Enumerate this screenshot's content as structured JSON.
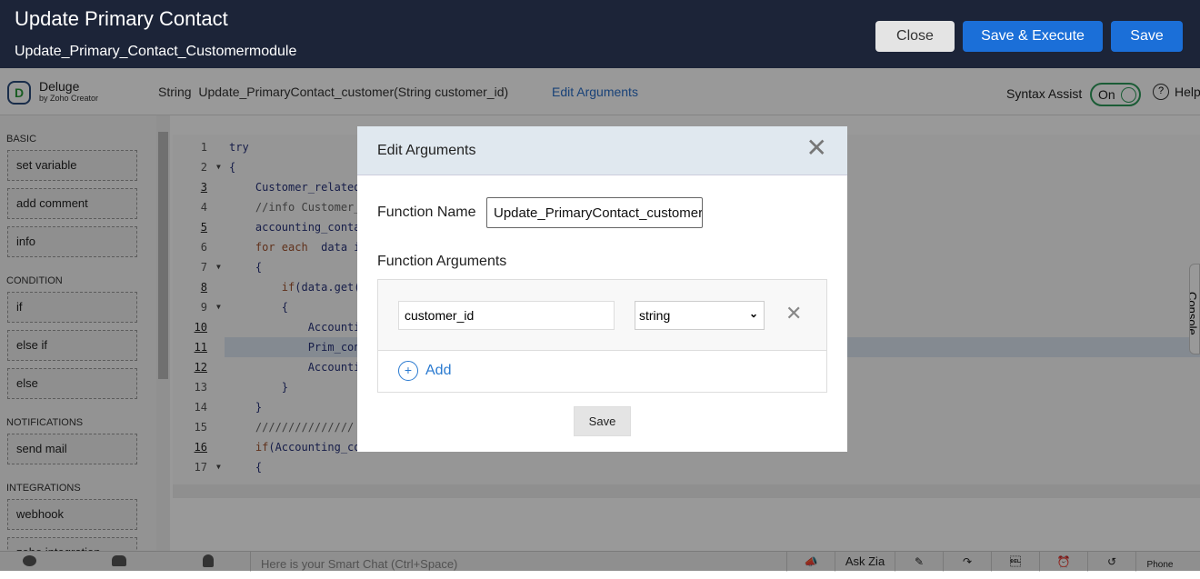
{
  "header": {
    "title": "Update Primary Contact",
    "subtitle": "Update_Primary_Contact_Customermodule",
    "close": "Close",
    "save_execute": "Save & Execute",
    "save": "Save"
  },
  "toolbar": {
    "logo_name": "Deluge",
    "logo_sub": "by Zoho Creator",
    "signature": "String  Update_PrimaryContact_customer(String customer_id)",
    "edit_arguments": "Edit Arguments",
    "syntax_assist": "Syntax Assist",
    "toggle": "On",
    "help": "Help"
  },
  "sidebar": {
    "sections": [
      {
        "title": "BASIC",
        "items": [
          "set variable",
          "add comment",
          "info"
        ]
      },
      {
        "title": "CONDITION",
        "items": [
          "if",
          "else if",
          "else"
        ]
      },
      {
        "title": "NOTIFICATIONS",
        "items": [
          "send mail"
        ]
      },
      {
        "title": "INTEGRATIONS",
        "items": [
          "webhook",
          "zoho integration"
        ]
      }
    ]
  },
  "code": {
    "lines": [
      {
        "n": "1",
        "t": "try"
      },
      {
        "n": "2",
        "t": "{"
      },
      {
        "n": "3",
        "t": "    Customer_related"
      },
      {
        "n": "4",
        "t": "    //info Customer_"
      },
      {
        "n": "5",
        "t": "    accounting_conta"
      },
      {
        "n": "6",
        "t": "    for each  data i"
      },
      {
        "n": "7",
        "t": "    {"
      },
      {
        "n": "8",
        "t": "        if(data.get("
      },
      {
        "n": "9",
        "t": "        {"
      },
      {
        "n": "10",
        "t": "            Accounti"
      },
      {
        "n": "11",
        "t": "            Prim_con"
      },
      {
        "n": "12",
        "t": "            Accounti"
      },
      {
        "n": "13",
        "t": "        }"
      },
      {
        "n": "14",
        "t": "    }"
      },
      {
        "n": "15",
        "t": "    ///////////////"
      },
      {
        "n": "16",
        "t": "    if(Accounting_co"
      },
      {
        "n": "17",
        "t": "    {"
      }
    ],
    "highlighted_line": 11
  },
  "console_tab": "Console",
  "footer": {
    "chat_placeholder": "Here is your Smart Chat (Ctrl+Space)",
    "ask_zia": "Ask Zia",
    "phone": "Phone"
  },
  "dialog": {
    "title": "Edit Arguments",
    "function_name_label": "Function Name",
    "function_name_value": "Update_PrimaryContact_customer",
    "arguments_label": "Function Arguments",
    "argument_name": "customer_id",
    "argument_type": "string",
    "add": "Add",
    "save": "Save"
  },
  "colors": {
    "header_bg": "#1c2438",
    "primary": "#1b6fd8",
    "link": "#2a6fc9",
    "toggle": "#2e9a5a"
  }
}
